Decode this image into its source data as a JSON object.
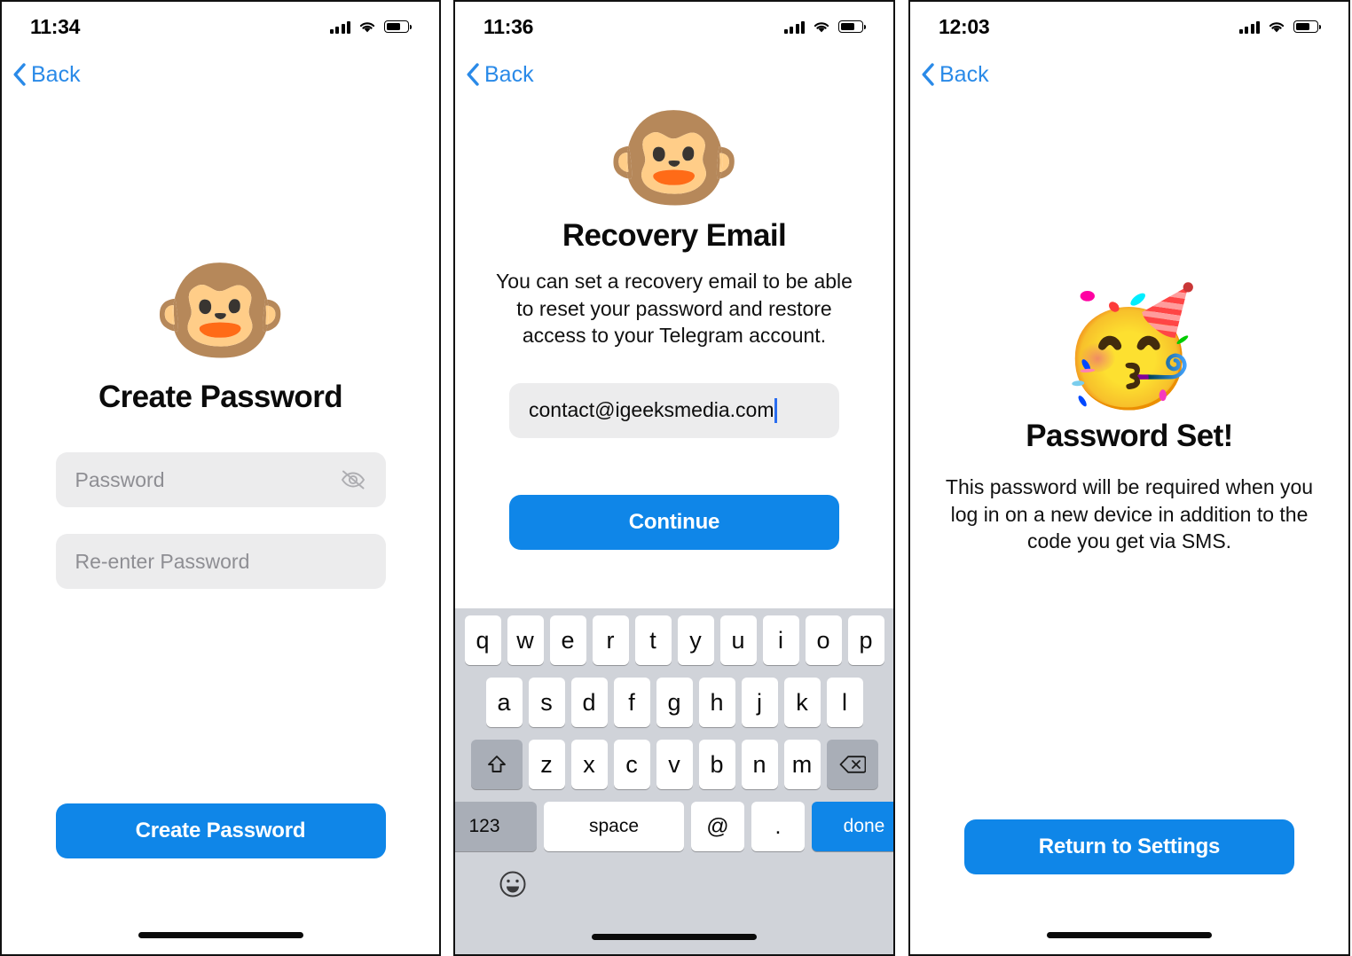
{
  "panels": [
    {
      "id": "create-password",
      "status": {
        "time": "11:34",
        "signal_icon": "cellular-signal-icon",
        "wifi_icon": "wifi-icon",
        "battery_icon": "battery-icon"
      },
      "nav": {
        "back_label": "Back",
        "back_icon": "chevron-left-icon"
      },
      "emoji": "🐵",
      "emoji_name": "monkey-face-emoji",
      "title": "Create Password",
      "fields": [
        {
          "name": "password-input",
          "placeholder": "Password",
          "value": "",
          "trailing_icon": "eye-slash-icon"
        },
        {
          "name": "confirm-password-input",
          "placeholder": "Re-enter Password",
          "value": "",
          "trailing_icon": ""
        }
      ],
      "cta": "Create Password"
    },
    {
      "id": "recovery-email",
      "status": {
        "time": "11:36",
        "signal_icon": "cellular-signal-icon",
        "wifi_icon": "wifi-icon",
        "battery_icon": "battery-icon"
      },
      "nav": {
        "back_label": "Back",
        "back_icon": "chevron-left-icon"
      },
      "emoji": "🐵",
      "emoji_name": "monkey-face-emoji",
      "title": "Recovery Email",
      "subtitle": "You can set a recovery email to be able to reset your password and restore access to your Telegram account.",
      "email_field": {
        "name": "recovery-email-input",
        "value": "contact@igeeksmedia.com",
        "placeholder": "",
        "has_caret": true
      },
      "cta": "Continue",
      "keyboard": {
        "row1": [
          "q",
          "w",
          "e",
          "r",
          "t",
          "y",
          "u",
          "i",
          "o",
          "p"
        ],
        "row2": [
          "a",
          "s",
          "d",
          "f",
          "g",
          "h",
          "j",
          "k",
          "l"
        ],
        "row3_shift": "shift-key",
        "row3": [
          "z",
          "x",
          "c",
          "v",
          "b",
          "n",
          "m"
        ],
        "row3_delete": "delete-key",
        "numbers_label": "123",
        "space_label": "space",
        "at_label": "@",
        "dot_label": ".",
        "done_label": "done",
        "emoji_key": "emoji-key"
      }
    },
    {
      "id": "password-set",
      "status": {
        "time": "12:03",
        "signal_icon": "cellular-signal-icon",
        "wifi_icon": "wifi-icon",
        "battery_icon": "battery-icon"
      },
      "nav": {
        "back_label": "Back",
        "back_icon": "chevron-left-icon"
      },
      "emoji": "🥳",
      "emoji_name": "partying-face-emoji",
      "title": "Password Set!",
      "subtitle": "This password will be required when you log in on a new device in addition to the code you get via SMS.",
      "cta": "Return to Settings"
    }
  ],
  "colors": {
    "accent_blue": "#0f86e8",
    "link_blue": "#2a8ae8",
    "field_gray": "#ececed",
    "placeholder_gray": "#8e8e93",
    "keyboard_bg": "#d0d3d9",
    "key_white": "#ffffff",
    "key_gray": "#a9aeb7",
    "caret_blue": "#2a6df0"
  }
}
